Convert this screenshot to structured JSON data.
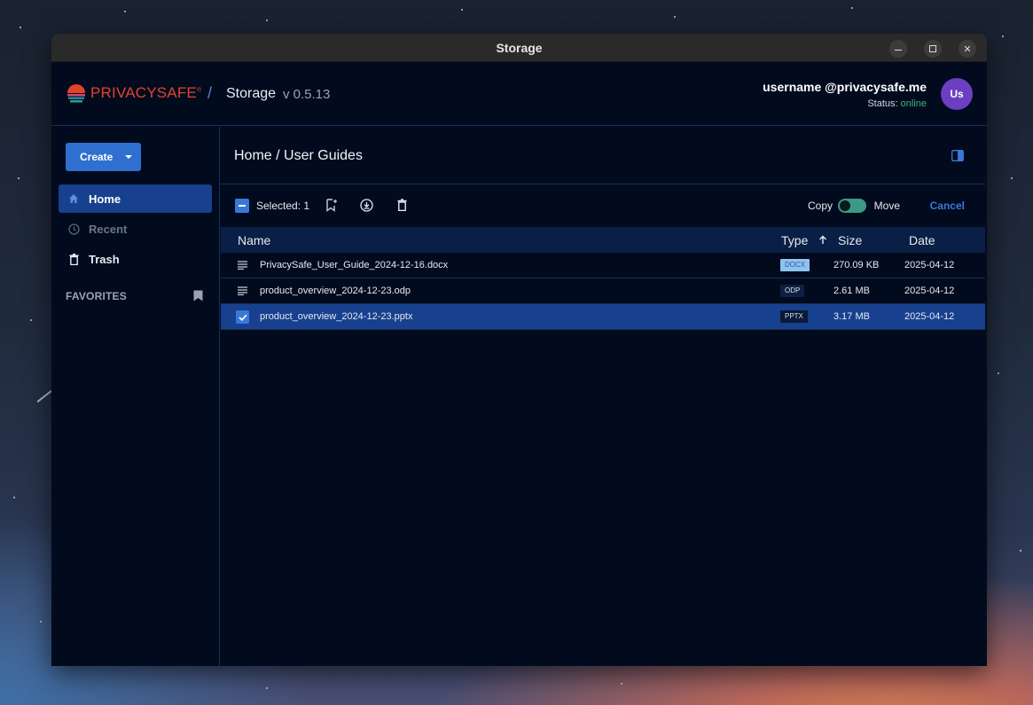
{
  "window": {
    "title": "Storage"
  },
  "header": {
    "brand": "PRIVACYSAFE",
    "brand_mark": "®",
    "separator": "/",
    "app_name": "Storage",
    "version": "v 0.5.13",
    "username": "username @privacysafe.me",
    "status_label": "Status:",
    "status_value": "online",
    "avatar_initials": "Us"
  },
  "sidebar": {
    "create_label": "Create",
    "items": [
      {
        "label": "Home",
        "icon": "home-icon",
        "active": true
      },
      {
        "label": "Recent",
        "icon": "clock-icon",
        "active": false
      },
      {
        "label": "Trash",
        "icon": "trash-icon",
        "active": false
      }
    ],
    "favorites_label": "FAVORITES"
  },
  "main": {
    "breadcrumb": "Home / User Guides",
    "selection": {
      "selected_text": "Selected: 1",
      "copy_label": "Copy",
      "move_label": "Move",
      "cancel_label": "Cancel"
    },
    "columns": {
      "name": "Name",
      "type": "Type",
      "size": "Size",
      "date": "Date"
    },
    "files": [
      {
        "name": "PrivacySafe_User_Guide_2024-12-16.docx",
        "type": "DOCX",
        "size": "270.09 KB",
        "date": "2025-04-12",
        "selected": false
      },
      {
        "name": "product_overview_2024-12-23.odp",
        "type": "ODP",
        "size": "2.61 MB",
        "date": "2025-04-12",
        "selected": false
      },
      {
        "name": "product_overview_2024-12-23.pptx",
        "type": "PPTX",
        "size": "3.17 MB",
        "date": "2025-04-12",
        "selected": true
      }
    ]
  },
  "colors": {
    "background": "#020b1e",
    "accent": "#2f6fd0",
    "selected_row": "#17408e",
    "brand": "#e0442c",
    "online": "#3fb57a",
    "avatar": "#6b3ec2"
  }
}
